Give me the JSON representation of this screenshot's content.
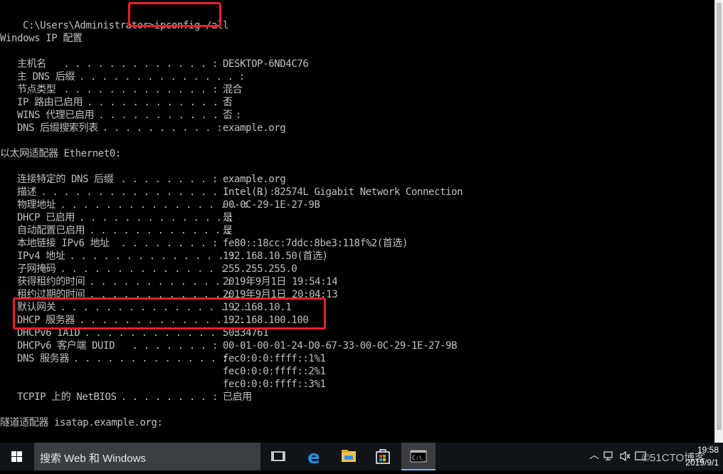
{
  "console": {
    "prompt": "C:\\Users\\Administrator>",
    "command": "ipconfig /all",
    "windows_header": "Windows IP 配置",
    "windows_ip": [
      {
        "label": "主机名",
        "dots": ". . . . . . . . . . . . . :",
        "value": "DESKTOP-6ND4C76"
      },
      {
        "label": "主 DNS 后缀",
        "dots": ". . . . . . . . . . . . . . :",
        "value": ""
      },
      {
        "label": "节点类型",
        "dots": ". . . . . . . . . . . . . :",
        "value": "混合"
      },
      {
        "label": "IP 路由已启用",
        "dots": ". . . . . . . . . . . . :",
        "value": "否"
      },
      {
        "label": "WINS 代理已启用",
        "dots": ". . . . . . . . . . . . :",
        "value": "否"
      },
      {
        "label": "DNS 后缀搜索列表",
        "dots": ". . . . . . . . . . :",
        "value": "example.org"
      }
    ],
    "ethernet_header": "以太网适配器 Ethernet0:",
    "ethernet": [
      {
        "label": "连接特定的 DNS 后缀",
        "dots": ". . . . . . . . :",
        "value": "example.org"
      },
      {
        "label": "描述",
        "dots": ". . . . . . . . . . . . . . . . . . . . :",
        "value": "Intel(R) 82574L Gigabit Network Connection"
      },
      {
        "label": "物理地址",
        "dots": ". . . . . . . . . . . . . . . . :",
        "value": "00-0C-29-1E-27-9B"
      },
      {
        "label": "DHCP 已启用",
        "dots": ". . . . . . . . . . . . . :",
        "value": "是"
      },
      {
        "label": "自动配置已启用",
        "dots": ". . . . . . . . . . . . :",
        "value": "是"
      },
      {
        "label": "本地链接 IPv6 地址",
        "dots": ". . . . . . . . :",
        "value": "fe80::18cc:7ddc:8be3:118f%2(首选)"
      },
      {
        "label": "IPv4 地址",
        "dots": ". . . . . . . . . . . . . . :",
        "value": "192.168.10.50(首选)"
      },
      {
        "label": "子网掩码",
        "dots": ". . . . . . . . . . . . . . :",
        "value": "255.255.255.0"
      },
      {
        "label": "获得租约的时间",
        "dots": ". . . . . . . . . . . . :",
        "value": "2019年9月1日 19:54:14"
      },
      {
        "label": "租约过期的时间",
        "dots": ". . . . . . . . . . . . :",
        "value": "2019年9月1日 20:04:13"
      },
      {
        "label": "默认网关",
        "dots": ". . . . . . . . . . . . . . . . :",
        "value": "192.168.10.1"
      },
      {
        "label": "DHCP 服务器",
        "dots": ". . . . . . . . . . . . . . :",
        "value": "192.168.100.100"
      },
      {
        "label": "DHCPv6 IAID",
        "dots": ". . . . . . . . . . . . . :",
        "value": "50334761"
      },
      {
        "label": "DHCPv6 客户端 DUID",
        "dots": ". . . . . . . :",
        "value": "00-01-00-01-24-D0-67-33-00-0C-29-1E-27-9B"
      },
      {
        "label": "DNS 服务器",
        "dots": ". . . . . . . . . . . . . :",
        "value": "fec0:0:0:ffff::1%1"
      },
      {
        "label": "",
        "dots": "",
        "value": "fec0:0:0:ffff::2%1"
      },
      {
        "label": "",
        "dots": "",
        "value": "fec0:0:0:ffff::3%1"
      },
      {
        "label": "TCPIP 上的 NetBIOS",
        "dots": ". . . . . . . . :",
        "value": "已启用"
      }
    ],
    "tunnel_header": "隧道适配器 isatap.example.org:"
  },
  "taskbar": {
    "search_placeholder": "搜索 Web 和 Windows",
    "icons": [
      "start-icon",
      "task-view-icon",
      "edge-icon",
      "file-explorer-icon",
      "store-icon",
      "cmd-icon"
    ],
    "clock_time": "19:58",
    "clock_date": "2019/9/1",
    "watermark": "©51CTO博客",
    "accent": "#7fb3e6"
  },
  "highlight_color": "#e8202a"
}
